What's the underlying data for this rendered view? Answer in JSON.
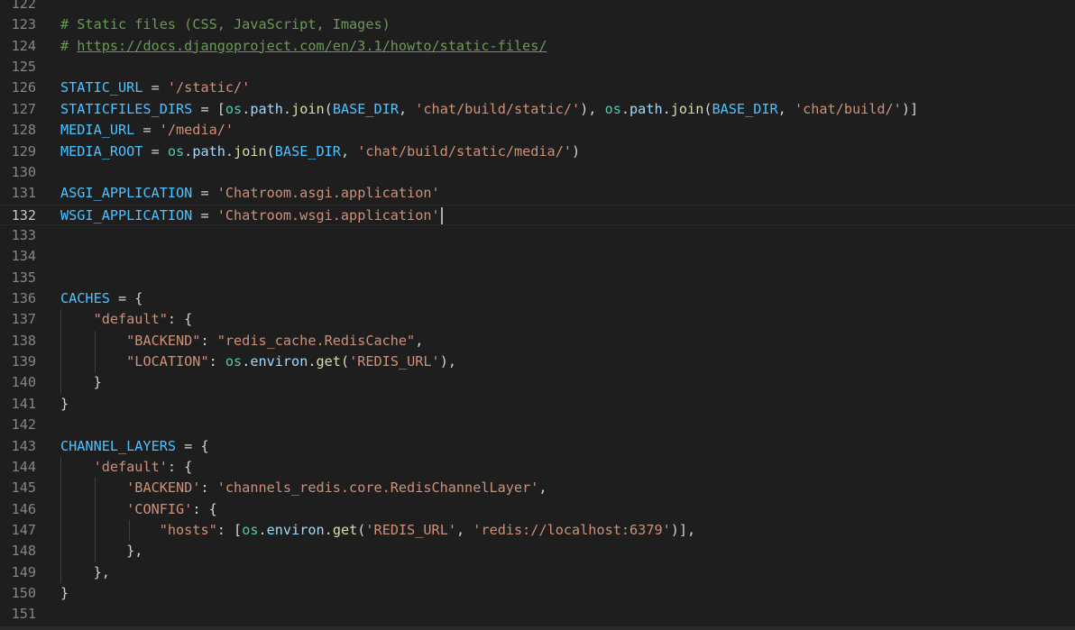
{
  "editor": {
    "language": "python",
    "cursor_line": 132,
    "lines": [
      {
        "n": "122",
        "indent": 0,
        "tokens": []
      },
      {
        "n": "123",
        "indent": 0,
        "tokens": [
          {
            "t": "# Static files (CSS, JavaScript, Images)",
            "c": "comment"
          }
        ]
      },
      {
        "n": "124",
        "indent": 0,
        "tokens": [
          {
            "t": "# ",
            "c": "comment"
          },
          {
            "t": "https://docs.djangoproject.com/en/3.1/howto/static-files/",
            "c": "link"
          }
        ]
      },
      {
        "n": "125",
        "indent": 0,
        "tokens": []
      },
      {
        "n": "126",
        "indent": 0,
        "tokens": [
          {
            "t": "STATIC_URL",
            "c": "const"
          },
          {
            "t": " = ",
            "c": "op"
          },
          {
            "t": "'/static/'",
            "c": "str"
          }
        ]
      },
      {
        "n": "127",
        "indent": 0,
        "tokens": [
          {
            "t": "STATICFILES_DIRS",
            "c": "const"
          },
          {
            "t": " = [",
            "c": "op"
          },
          {
            "t": "os",
            "c": "module"
          },
          {
            "t": ".",
            "c": "op"
          },
          {
            "t": "path",
            "c": "var"
          },
          {
            "t": ".",
            "c": "op"
          },
          {
            "t": "join",
            "c": "func"
          },
          {
            "t": "(",
            "c": "op"
          },
          {
            "t": "BASE_DIR",
            "c": "const"
          },
          {
            "t": ", ",
            "c": "op"
          },
          {
            "t": "'chat/build/static/'",
            "c": "str"
          },
          {
            "t": "), ",
            "c": "op"
          },
          {
            "t": "os",
            "c": "module"
          },
          {
            "t": ".",
            "c": "op"
          },
          {
            "t": "path",
            "c": "var"
          },
          {
            "t": ".",
            "c": "op"
          },
          {
            "t": "join",
            "c": "func"
          },
          {
            "t": "(",
            "c": "op"
          },
          {
            "t": "BASE_DIR",
            "c": "const"
          },
          {
            "t": ", ",
            "c": "op"
          },
          {
            "t": "'chat/build/'",
            "c": "str"
          },
          {
            "t": ")]",
            "c": "op"
          }
        ]
      },
      {
        "n": "128",
        "indent": 0,
        "tokens": [
          {
            "t": "MEDIA_URL",
            "c": "const"
          },
          {
            "t": " = ",
            "c": "op"
          },
          {
            "t": "'/media/'",
            "c": "str"
          }
        ]
      },
      {
        "n": "129",
        "indent": 0,
        "tokens": [
          {
            "t": "MEDIA_ROOT",
            "c": "const"
          },
          {
            "t": " = ",
            "c": "op"
          },
          {
            "t": "os",
            "c": "module"
          },
          {
            "t": ".",
            "c": "op"
          },
          {
            "t": "path",
            "c": "var"
          },
          {
            "t": ".",
            "c": "op"
          },
          {
            "t": "join",
            "c": "func"
          },
          {
            "t": "(",
            "c": "op"
          },
          {
            "t": "BASE_DIR",
            "c": "const"
          },
          {
            "t": ", ",
            "c": "op"
          },
          {
            "t": "'chat/build/static/media/'",
            "c": "str"
          },
          {
            "t": ")",
            "c": "op"
          }
        ]
      },
      {
        "n": "130",
        "indent": 0,
        "tokens": []
      },
      {
        "n": "131",
        "indent": 0,
        "tokens": [
          {
            "t": "ASGI_APPLICATION",
            "c": "const"
          },
          {
            "t": " = ",
            "c": "op"
          },
          {
            "t": "'Chatroom.asgi.application'",
            "c": "str"
          }
        ]
      },
      {
        "n": "132",
        "indent": 0,
        "tokens": [
          {
            "t": "WSGI_APPLICATION",
            "c": "const"
          },
          {
            "t": " = ",
            "c": "op"
          },
          {
            "t": "'Chatroom.wsgi.application'",
            "c": "str"
          }
        ]
      },
      {
        "n": "133",
        "indent": 0,
        "tokens": []
      },
      {
        "n": "134",
        "indent": 0,
        "tokens": []
      },
      {
        "n": "135",
        "indent": 0,
        "tokens": []
      },
      {
        "n": "136",
        "indent": 0,
        "tokens": [
          {
            "t": "CACHES",
            "c": "const"
          },
          {
            "t": " = {",
            "c": "op"
          }
        ]
      },
      {
        "n": "137",
        "indent": 1,
        "tokens": [
          {
            "t": "    ",
            "c": "op"
          },
          {
            "t": "\"default\"",
            "c": "str"
          },
          {
            "t": ": {",
            "c": "op"
          }
        ]
      },
      {
        "n": "138",
        "indent": 2,
        "tokens": [
          {
            "t": "        ",
            "c": "op"
          },
          {
            "t": "\"BACKEND\"",
            "c": "str"
          },
          {
            "t": ": ",
            "c": "op"
          },
          {
            "t": "\"redis_cache.RedisCache\"",
            "c": "str"
          },
          {
            "t": ",",
            "c": "op"
          }
        ]
      },
      {
        "n": "139",
        "indent": 2,
        "tokens": [
          {
            "t": "        ",
            "c": "op"
          },
          {
            "t": "\"LOCATION\"",
            "c": "str"
          },
          {
            "t": ": ",
            "c": "op"
          },
          {
            "t": "os",
            "c": "module"
          },
          {
            "t": ".",
            "c": "op"
          },
          {
            "t": "environ",
            "c": "var"
          },
          {
            "t": ".",
            "c": "op"
          },
          {
            "t": "get",
            "c": "func"
          },
          {
            "t": "(",
            "c": "op"
          },
          {
            "t": "'REDIS_URL'",
            "c": "str"
          },
          {
            "t": "),",
            "c": "op"
          }
        ]
      },
      {
        "n": "140",
        "indent": 1,
        "tokens": [
          {
            "t": "    }",
            "c": "op"
          }
        ]
      },
      {
        "n": "141",
        "indent": 0,
        "tokens": [
          {
            "t": "}",
            "c": "op"
          }
        ]
      },
      {
        "n": "142",
        "indent": 0,
        "tokens": []
      },
      {
        "n": "143",
        "indent": 0,
        "tokens": [
          {
            "t": "CHANNEL_LAYERS",
            "c": "const"
          },
          {
            "t": " = {",
            "c": "op"
          }
        ]
      },
      {
        "n": "144",
        "indent": 1,
        "tokens": [
          {
            "t": "    ",
            "c": "op"
          },
          {
            "t": "'default'",
            "c": "str"
          },
          {
            "t": ": {",
            "c": "op"
          }
        ]
      },
      {
        "n": "145",
        "indent": 2,
        "tokens": [
          {
            "t": "        ",
            "c": "op"
          },
          {
            "t": "'BACKEND'",
            "c": "str"
          },
          {
            "t": ": ",
            "c": "op"
          },
          {
            "t": "'channels_redis.core.RedisChannelLayer'",
            "c": "str"
          },
          {
            "t": ",",
            "c": "op"
          }
        ]
      },
      {
        "n": "146",
        "indent": 2,
        "tokens": [
          {
            "t": "        ",
            "c": "op"
          },
          {
            "t": "'CONFIG'",
            "c": "str"
          },
          {
            "t": ": {",
            "c": "op"
          }
        ]
      },
      {
        "n": "147",
        "indent": 3,
        "tokens": [
          {
            "t": "            ",
            "c": "op"
          },
          {
            "t": "\"hosts\"",
            "c": "str"
          },
          {
            "t": ": [",
            "c": "op"
          },
          {
            "t": "os",
            "c": "module"
          },
          {
            "t": ".",
            "c": "op"
          },
          {
            "t": "environ",
            "c": "var"
          },
          {
            "t": ".",
            "c": "op"
          },
          {
            "t": "get",
            "c": "func"
          },
          {
            "t": "(",
            "c": "op"
          },
          {
            "t": "'REDIS_URL'",
            "c": "str"
          },
          {
            "t": ", ",
            "c": "op"
          },
          {
            "t": "'redis://localhost:6379'",
            "c": "str"
          },
          {
            "t": ")],",
            "c": "op"
          }
        ]
      },
      {
        "n": "148",
        "indent": 2,
        "tokens": [
          {
            "t": "        },",
            "c": "op"
          }
        ]
      },
      {
        "n": "149",
        "indent": 1,
        "tokens": [
          {
            "t": "    },",
            "c": "op"
          }
        ]
      },
      {
        "n": "150",
        "indent": 0,
        "tokens": [
          {
            "t": "}",
            "c": "op"
          }
        ]
      },
      {
        "n": "151",
        "indent": 0,
        "tokens": []
      }
    ]
  }
}
